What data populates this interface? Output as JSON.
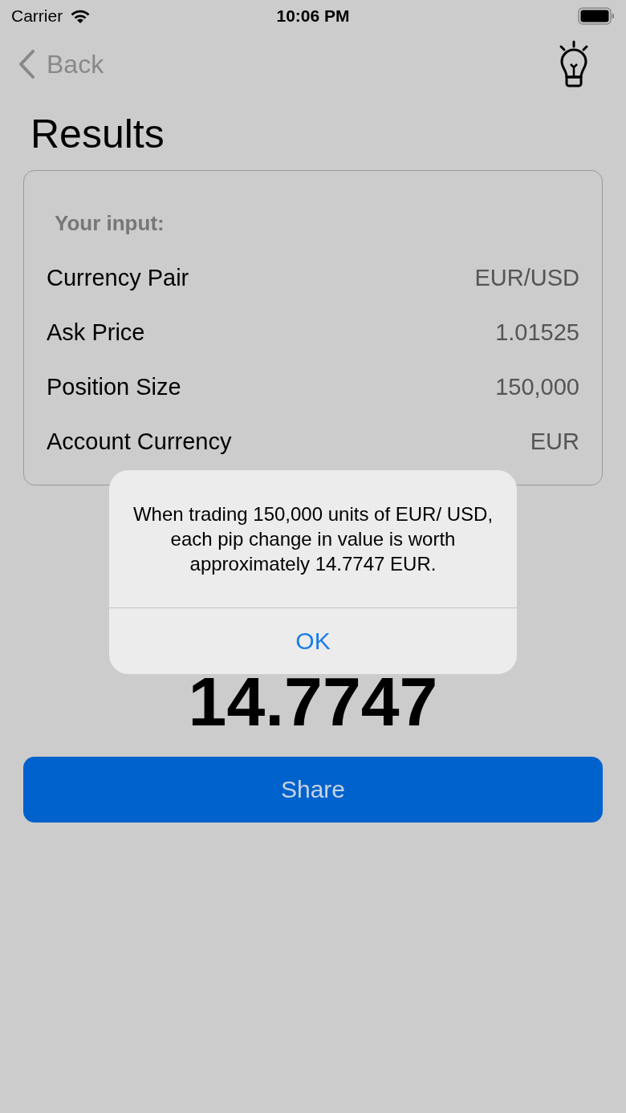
{
  "status_bar": {
    "carrier": "Carrier",
    "time": "10:06 PM"
  },
  "nav": {
    "back": "Back"
  },
  "title": "Results",
  "input_card": {
    "heading": "Your input:",
    "rows": [
      {
        "label": "Currency Pair",
        "value": "EUR/USD"
      },
      {
        "label": "Ask Price",
        "value": "1.01525"
      },
      {
        "label": "Position Size",
        "value": "150,000"
      },
      {
        "label": "Account Currency",
        "value": "EUR"
      }
    ]
  },
  "result_value": "14.7747",
  "share_button": "Share",
  "alert": {
    "message": "When trading 150,000 units of EUR/ USD, each pip change in value is worth approximately 14.7747 EUR.",
    "button": "OK"
  }
}
